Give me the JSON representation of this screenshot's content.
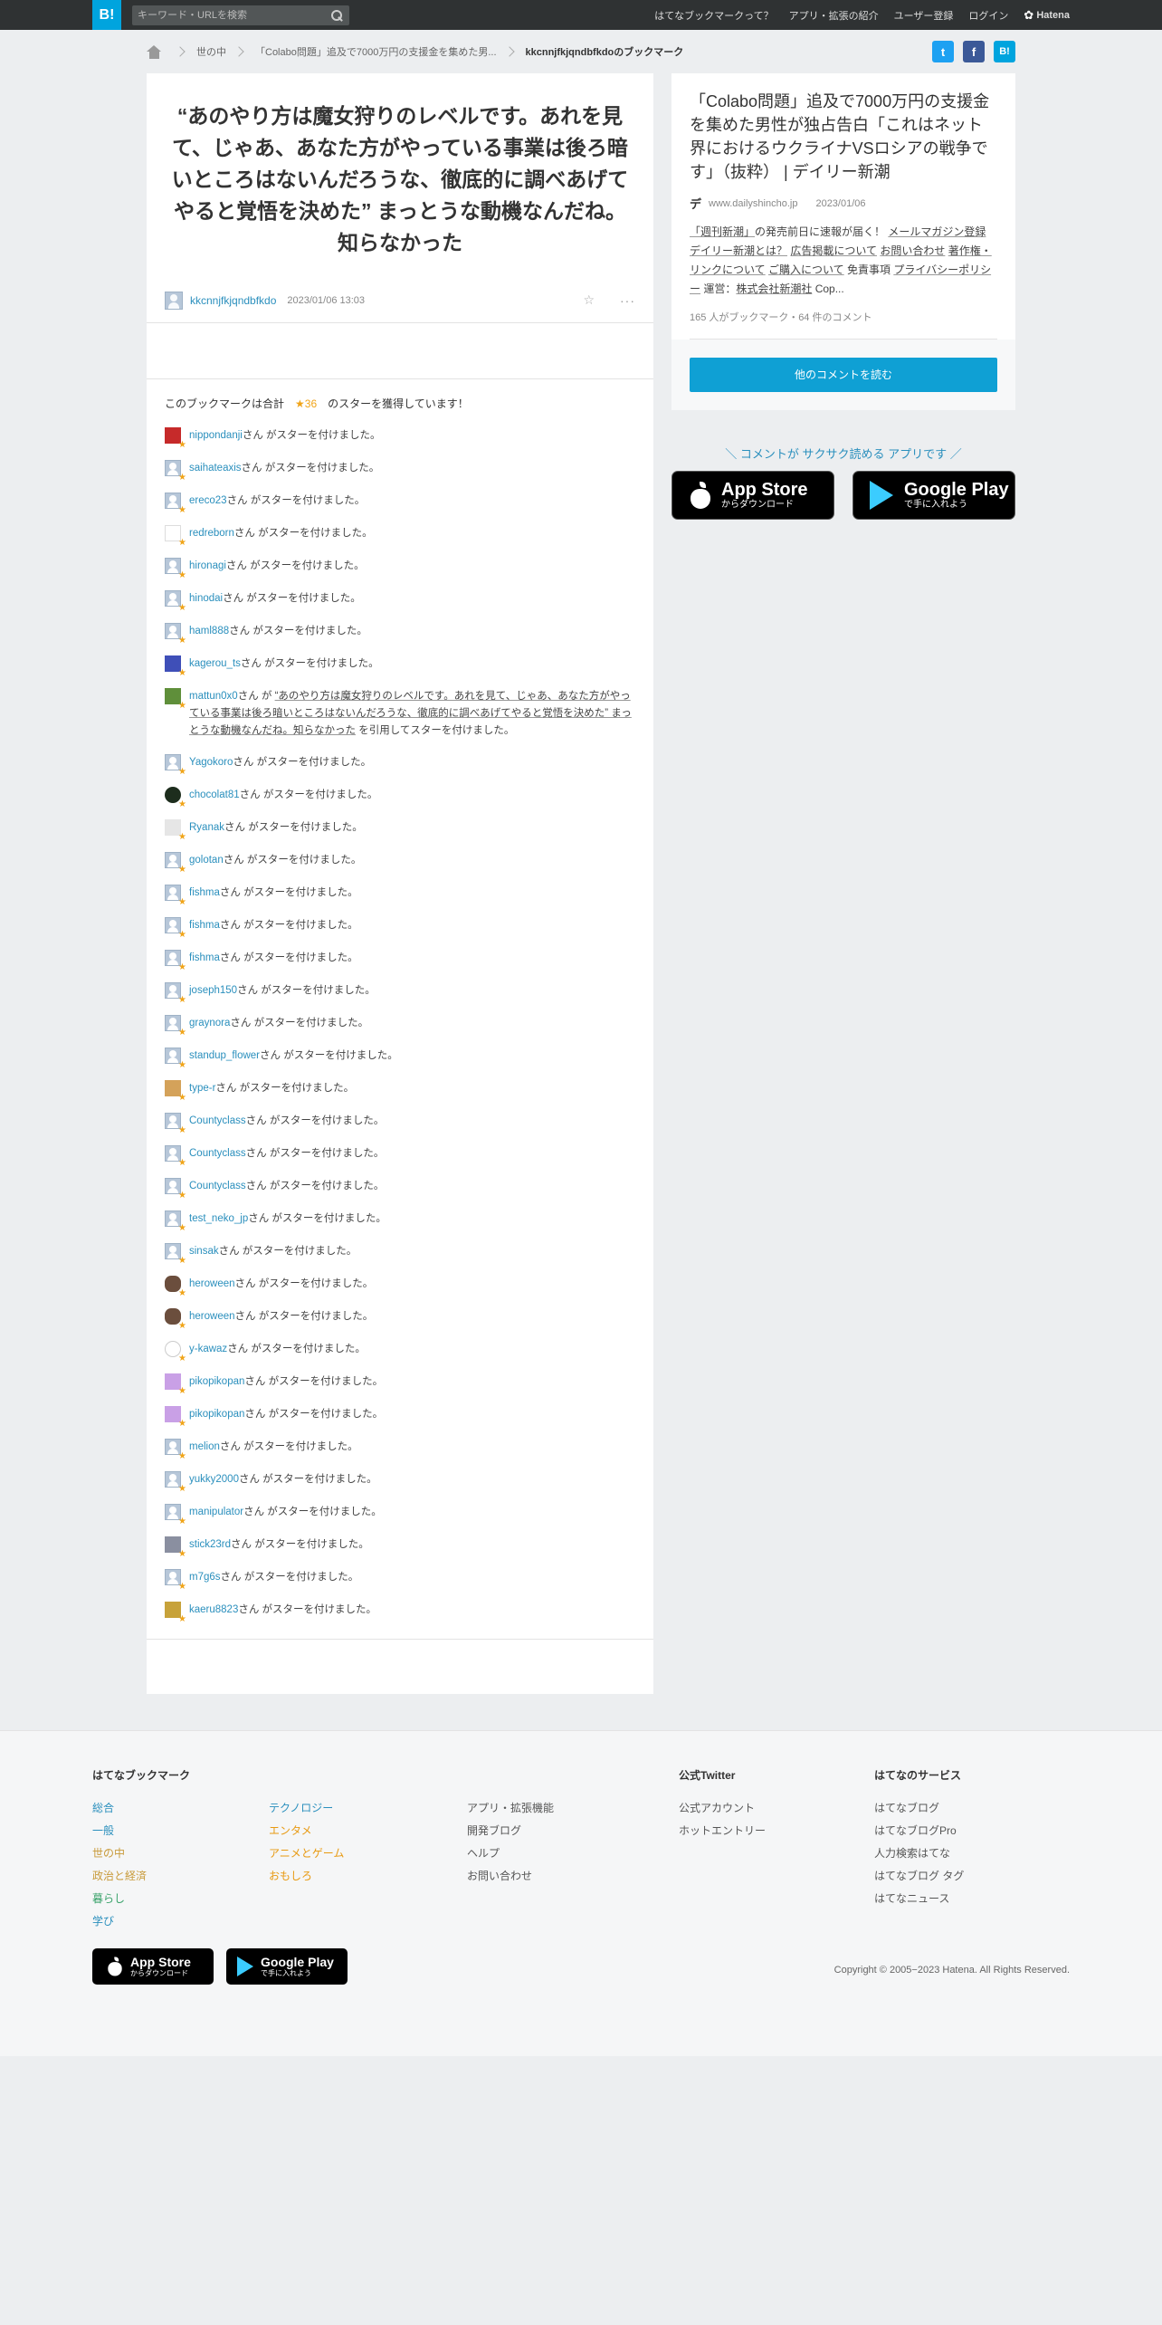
{
  "header": {
    "logo": "B!",
    "search_placeholder": "キーワード・URLを検索",
    "nav": [
      "はてなブックマークって？",
      "アプリ・拡張の紹介",
      "ユーザー登録",
      "ログイン"
    ],
    "brand": "Hatena"
  },
  "breadcrumb": {
    "items": [
      "世の中",
      "「Colabo問題」追及で7000万円の支援金を集めた男..."
    ],
    "current": "kkcnnjfkjqndbfkdoのブックマーク"
  },
  "share": {
    "twitter": "t",
    "facebook": "f",
    "hatena": "B!"
  },
  "comment": {
    "text": "“あのやり方は魔女狩りのレベルです。あれを見て、じゃあ、あなた方がやっている事業は後ろ暗いところはないんだろうな、徹底的に調べあげてやると覚悟を決めた” まっとうな動機なんだね。知らなかった",
    "user": "kkcnnjfkjqndbfkdo",
    "date": "2023/01/06 13:03"
  },
  "stars": {
    "summary_prefix": "このブックマークは合計",
    "count": "★36",
    "summary_suffix": "のスターを獲得しています！",
    "suffix_text": "さん がスターを付けました。",
    "items": [
      {
        "user": "nippondanji",
        "avatar": "red"
      },
      {
        "user": "saihateaxis",
        "avatar": "default"
      },
      {
        "user": "ereco23",
        "avatar": "default"
      },
      {
        "user": "redreborn",
        "avatar": "gr"
      },
      {
        "user": "hironagi",
        "avatar": "default"
      },
      {
        "user": "hinodai",
        "avatar": "default"
      },
      {
        "user": "haml888",
        "avatar": "default"
      },
      {
        "user": "kagerou_ts",
        "avatar": "blue"
      },
      {
        "user": "Yagokoro",
        "avatar": "default"
      },
      {
        "user": "chocolat81",
        "avatar": "dark"
      },
      {
        "user": "Ryanak",
        "avatar": "light"
      },
      {
        "user": "golotan",
        "avatar": "default"
      },
      {
        "user": "fishma",
        "avatar": "default"
      },
      {
        "user": "fishma",
        "avatar": "default"
      },
      {
        "user": "fishma",
        "avatar": "default"
      },
      {
        "user": "joseph150",
        "avatar": "default"
      },
      {
        "user": "graynora",
        "avatar": "default"
      },
      {
        "user": "standup_flower",
        "avatar": "default"
      },
      {
        "user": "type-r",
        "avatar": "orange"
      },
      {
        "user": "Countyclass",
        "avatar": "default"
      },
      {
        "user": "Countyclass",
        "avatar": "default"
      },
      {
        "user": "Countyclass",
        "avatar": "default"
      },
      {
        "user": "test_neko_jp",
        "avatar": "default"
      },
      {
        "user": "sinsak",
        "avatar": "default"
      },
      {
        "user": "heroween",
        "avatar": "pumpkin"
      },
      {
        "user": "heroween",
        "avatar": "pumpkin"
      },
      {
        "user": "y-kawaz",
        "avatar": "face"
      },
      {
        "user": "pikopikopan",
        "avatar": "purple"
      },
      {
        "user": "pikopikopan",
        "avatar": "purple"
      },
      {
        "user": "melion",
        "avatar": "default"
      },
      {
        "user": "yukky2000",
        "avatar": "default"
      },
      {
        "user": "manipulator",
        "avatar": "default"
      },
      {
        "user": "stick23rd",
        "avatar": "gray"
      },
      {
        "user": "m7g6s",
        "avatar": "default"
      },
      {
        "user": "kaeru8823",
        "avatar": "frog"
      }
    ],
    "quote_item": {
      "user": "mattun0x0",
      "prefix": "さん が",
      "quote": "“あのやり方は魔女狩りのレベルです。あれを見て、じゃあ、あなた方がやっている事業は後ろ暗いところはないんだろうな、徹底的に調べあげてやると覚悟を決めた” まっとうな動機なんだね。知らなかった",
      "suffix": "を引用してスターを付けました。",
      "insert_after": 7
    }
  },
  "entry": {
    "title": "「Colabo問題」追及で7000万円の支援金を集めた男性が独占告白「これはネット界におけるウクライナVSロシアの戦争です」（抜粋） | デイリー新潮",
    "favicon": "デ",
    "domain": "www.dailyshincho.jp",
    "date": "2023/01/06",
    "desc": [
      {
        "t": "「週刊新潮」",
        "u": true
      },
      {
        "t": "の発売前日に速報が届く！ ",
        "u": false
      },
      {
        "t": "メールマガジン登録",
        "u": true
      },
      {
        "t": " ",
        "u": false
      },
      {
        "t": "デイリー新潮とは？",
        "u": true
      },
      {
        "t": " ",
        "u": false
      },
      {
        "t": "広告掲載について",
        "u": true
      },
      {
        "t": " ",
        "u": false
      },
      {
        "t": "お問い合わせ",
        "u": true
      },
      {
        "t": " ",
        "u": false
      },
      {
        "t": "著作権・リンクについて",
        "u": true
      },
      {
        "t": " ",
        "u": false
      },
      {
        "t": "ご購入について",
        "u": true
      },
      {
        "t": " 免責事項 ",
        "u": false
      },
      {
        "t": "プライバシーポリシー",
        "u": true
      },
      {
        "t": " 運営：",
        "u": false
      },
      {
        "t": "株式会社新潮社",
        "u": true
      },
      {
        "t": " Cop...",
        "u": false
      }
    ],
    "stats": "165 人がブックマーク・64 件のコメント",
    "read_button": "他のコメントを読む"
  },
  "app": {
    "promo": "＼ コメントが サクサク読める アプリです ／",
    "appstore_big": "App Store",
    "appstore_small": "からダウンロード",
    "google_big": "Google Play",
    "google_small": "で手に入れよう"
  },
  "footer": {
    "col1_title": "はてなブックマーク",
    "col1_links": [
      {
        "label": "総合",
        "color": "c-blue"
      },
      {
        "label": "一般",
        "color": "c-blue"
      },
      {
        "label": "世の中",
        "color": "c-gold"
      },
      {
        "label": "政治と経済",
        "color": "c-gold"
      },
      {
        "label": "暮らし",
        "color": "c-green"
      },
      {
        "label": "学び",
        "color": "c-blue"
      }
    ],
    "col2_links": [
      {
        "label": "テクノロジー",
        "color": "c-blue"
      },
      {
        "label": "エンタメ",
        "color": "c-orange"
      },
      {
        "label": "アニメとゲーム",
        "color": "c-orange"
      },
      {
        "label": "おもしろ",
        "color": "c-orange"
      }
    ],
    "col3_links": [
      "アプリ・拡張機能",
      "開発ブログ",
      "ヘルプ",
      "お問い合わせ"
    ],
    "col4_title": "公式Twitter",
    "col4_links": [
      "公式アカウント",
      "ホットエントリー"
    ],
    "col5_title": "はてなのサービス",
    "col5_links": [
      "はてなブログ",
      "はてなブログPro",
      "人力検索はてな",
      "はてなブログ タグ",
      "はてなニュース"
    ],
    "copyright": "Copyright © 2005−2023 Hatena. All Rights Reserved."
  }
}
